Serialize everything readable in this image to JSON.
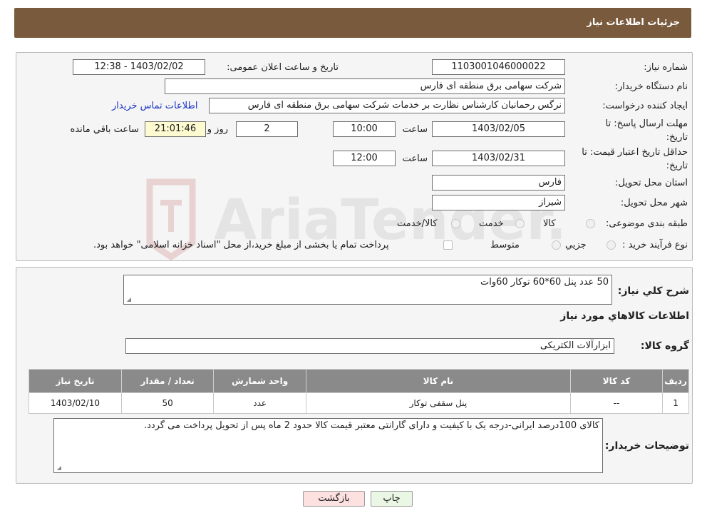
{
  "header": {
    "title": "جزئیات اطلاعات نیاز"
  },
  "form": {
    "need_number_label": "شماره نیاز:",
    "need_number": "1103001046000022",
    "announce_label": "تاریخ و ساعت اعلان عمومی:",
    "announce_value": "1403/02/02 - 12:38",
    "buyer_org_label": "نام دستگاه خریدار:",
    "buyer_org": "شرکت سهامی برق منطقه ای فارس",
    "creator_label": "ایجاد کننده درخواست:",
    "creator": "نرگس رحمانیان کارشناس نظارت بر خدمات شرکت سهامی برق منطقه ای فارس",
    "contact_link": "اطلاعات تماس خریدار",
    "deadline_label_1": "مهلت ارسال پاسخ: تا",
    "deadline_label_2": "تاریخ:",
    "deadline_date": "1403/02/05",
    "time_label": "ساعت",
    "deadline_time": "10:00",
    "days_value": "2",
    "days_label": "روز و",
    "remaining_time": "21:01:46",
    "remaining_label": "ساعت باقي مانده",
    "validity_label_1": "حداقل تاریخ اعتبار قیمت: تا",
    "validity_label_2": "تاریخ:",
    "validity_date": "1403/02/31",
    "validity_time": "12:00",
    "province_label": "استان محل تحویل:",
    "province": "فارس",
    "city_label": "شهر محل تحویل:",
    "city": "شیراز",
    "category_label": "طبقه بندی موضوعی:",
    "category_options": [
      "کالا",
      "خدمت",
      "کالا/خدمت"
    ],
    "process_label": "نوع فرآیند خرید :",
    "process_options": [
      "جزيي",
      "متوسط"
    ],
    "payment_note": "پرداخت تمام یا بخشی از مبلغ خرید،از محل \"اسناد خزانه اسلامی\" خواهد بود."
  },
  "details": {
    "summary_label": "شرح کلي نياز:",
    "summary": "50 عدد پنل 60*60 توکار 60وات",
    "goods_info_title": "اطلاعات کالاهاي مورد نياز",
    "group_label": "گروه کالا:",
    "group_value": "ابزارآلات الکتریکی",
    "table_headers": [
      "رديف",
      "کد کالا",
      "نام کالا",
      "واحد شمارش",
      "تعداد / مقدار",
      "تاریخ نیاز"
    ],
    "rows": [
      [
        "1",
        "--",
        "پنل سقفی توکار",
        "عدد",
        "50",
        "1403/02/10"
      ]
    ],
    "buyer_notes_label": "توضیحات خریدار:",
    "buyer_notes": "کالای 100درصد ایرانی-درجه یک با کیفیت و دارای گارانتی معتبر قیمت کالا حدود 2 ماه پس از تحویل پرداخت می گردد."
  },
  "buttons": {
    "print": "چاپ",
    "back": "بازگشت"
  },
  "watermark": {
    "text": "AriaTender.neT"
  },
  "colors": {
    "header": "#7a5a3c",
    "table_header": "#8a8a8a",
    "back_button": "#fde0e0",
    "print_button": "#eaf7e4",
    "link": "#1a33c4"
  }
}
